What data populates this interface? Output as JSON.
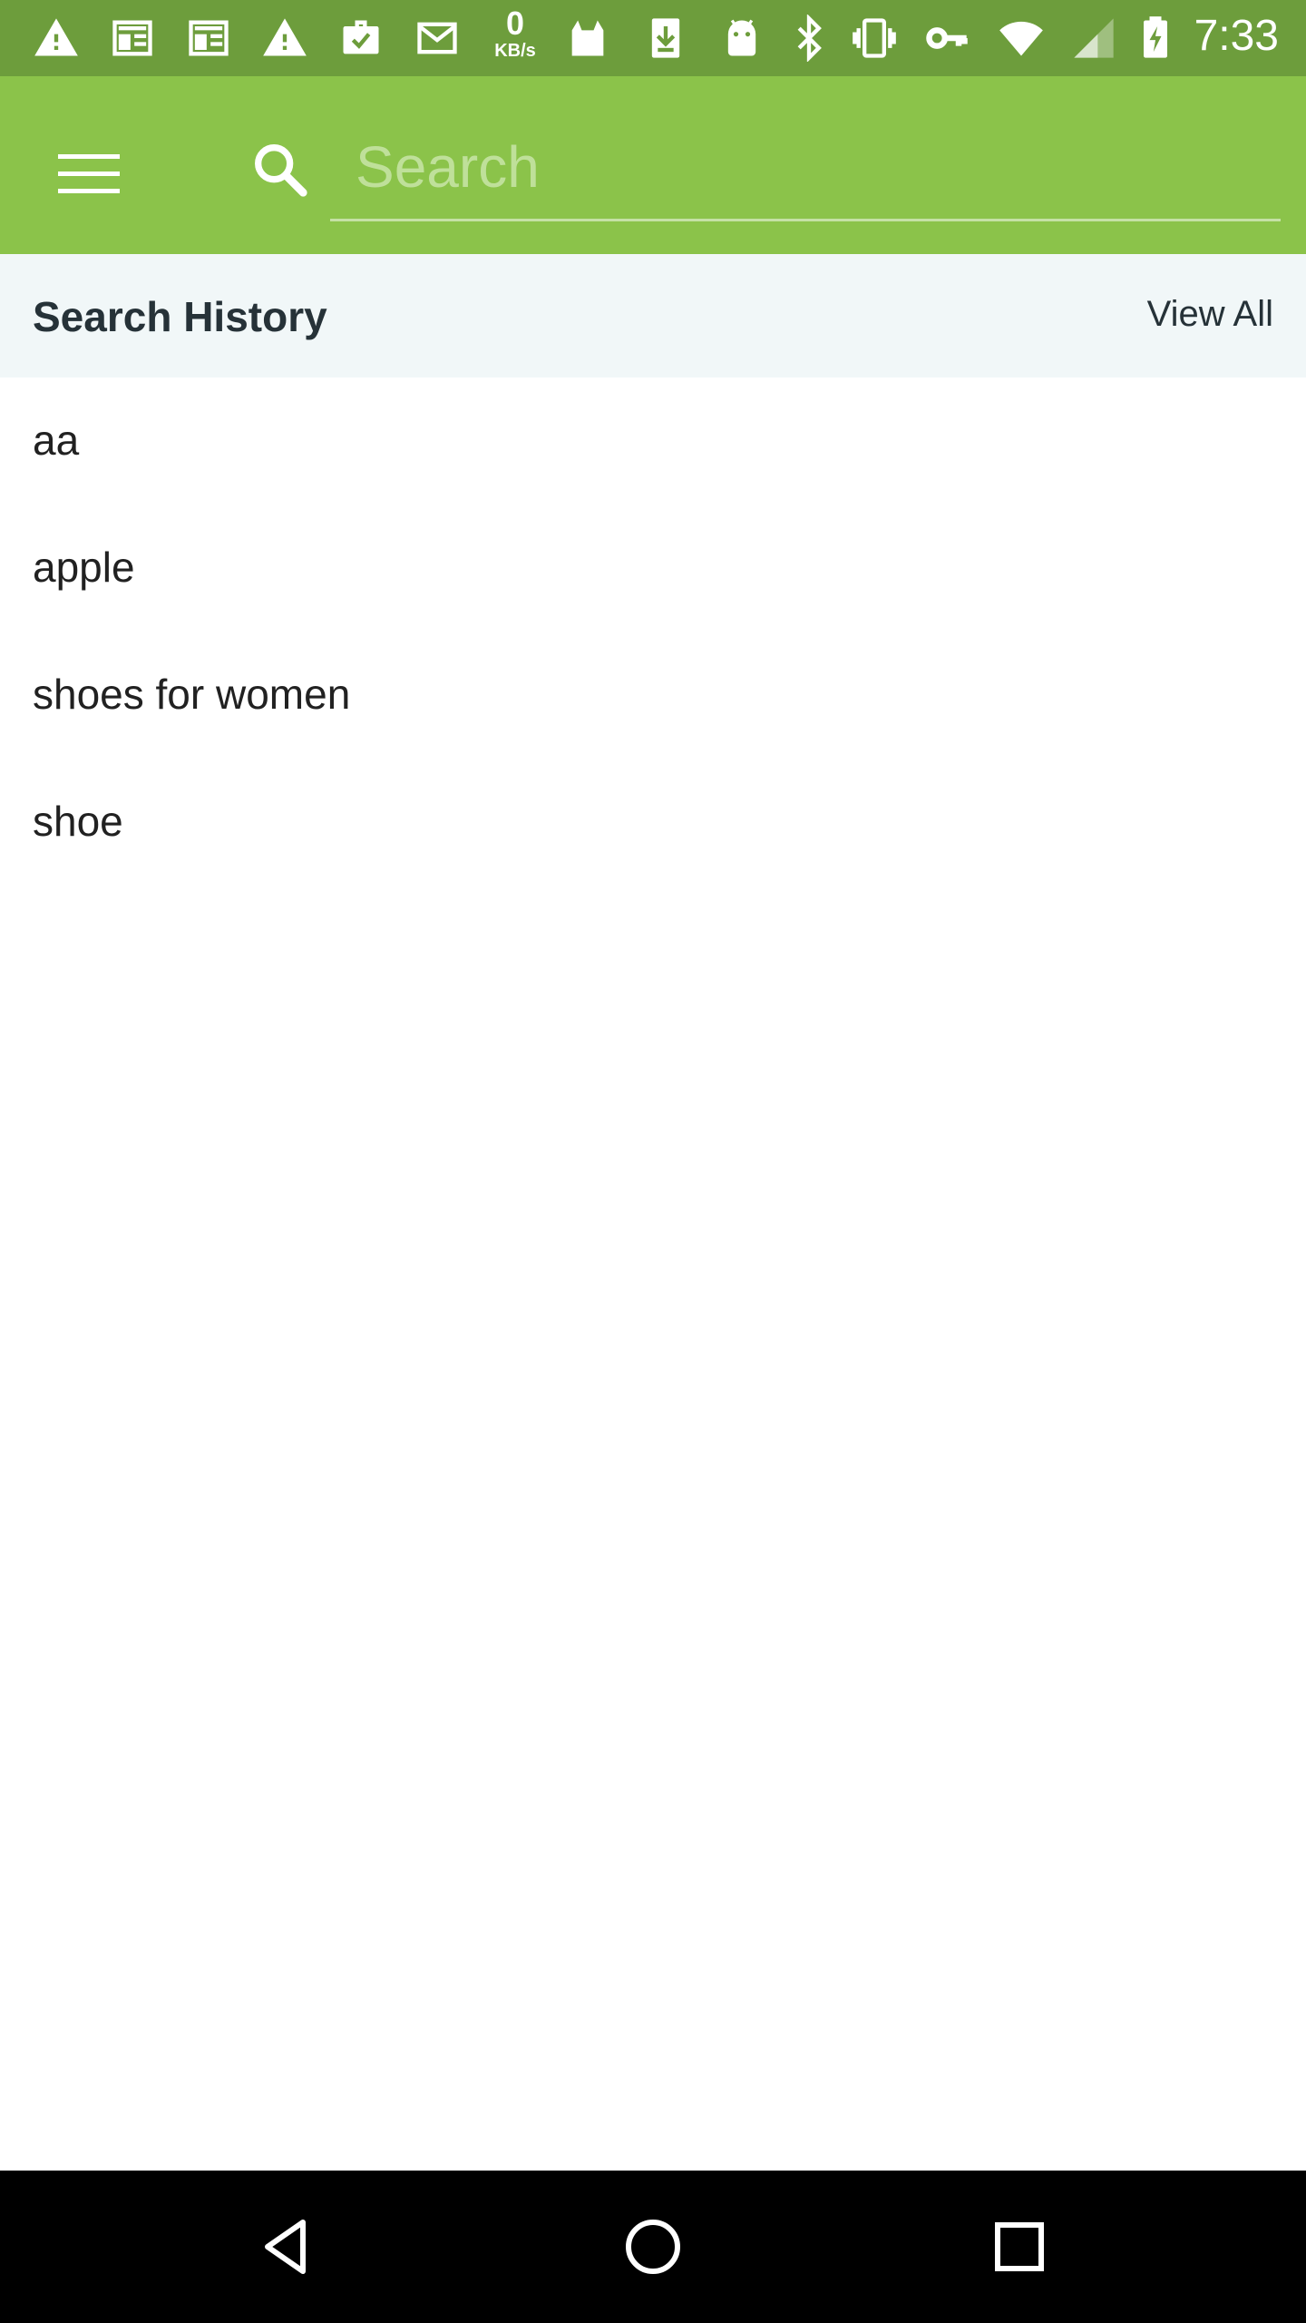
{
  "status_bar": {
    "time": "7:33",
    "net_speed_value": "0",
    "net_speed_unit": "KB/s",
    "icons": [
      "warning-icon",
      "news-icon",
      "news-icon",
      "warning-icon",
      "briefcase-check-icon",
      "gmail-icon",
      "net-speed",
      "cat-icon",
      "download-icon",
      "android-icon",
      "bluetooth-icon",
      "vibrate-icon",
      "key-icon",
      "wifi-icon",
      "signal-icon",
      "battery-charging-icon"
    ],
    "color": "#6d9d3c"
  },
  "app_bar": {
    "color": "#8bc34a",
    "search_placeholder": "Search"
  },
  "search_history": {
    "title": "Search History",
    "view_all_label": "View All",
    "items": [
      "aa",
      "apple",
      "shoes for women",
      "shoe"
    ]
  },
  "nav_bar": {
    "buttons": [
      "back-icon",
      "home-icon",
      "recents-icon"
    ]
  }
}
